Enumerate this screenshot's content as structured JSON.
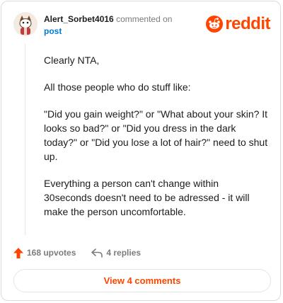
{
  "comment": {
    "username": "Alert_Sorbet4016",
    "action_text": "commented on",
    "post_link": "post",
    "paragraphs": [
      "Clearly NTA,",
      "All those people who do stuff like:",
      "\"Did you gain weight?\" or \"What about your skin? It looks so bad?\" or \"Did you dress in the dark today?\" or \"Did you lose a lot of hair?\" need to shut up.",
      "Everything a person can't change within 30seconds doesn't need to be adressed - it will make the person uncomfortable."
    ]
  },
  "brand": {
    "logo_text": "reddit",
    "color": "#ff4500"
  },
  "actions": {
    "upvotes": "168 upvotes",
    "replies": "4 replies"
  },
  "footer": {
    "view_comments": "View 4 comments"
  }
}
